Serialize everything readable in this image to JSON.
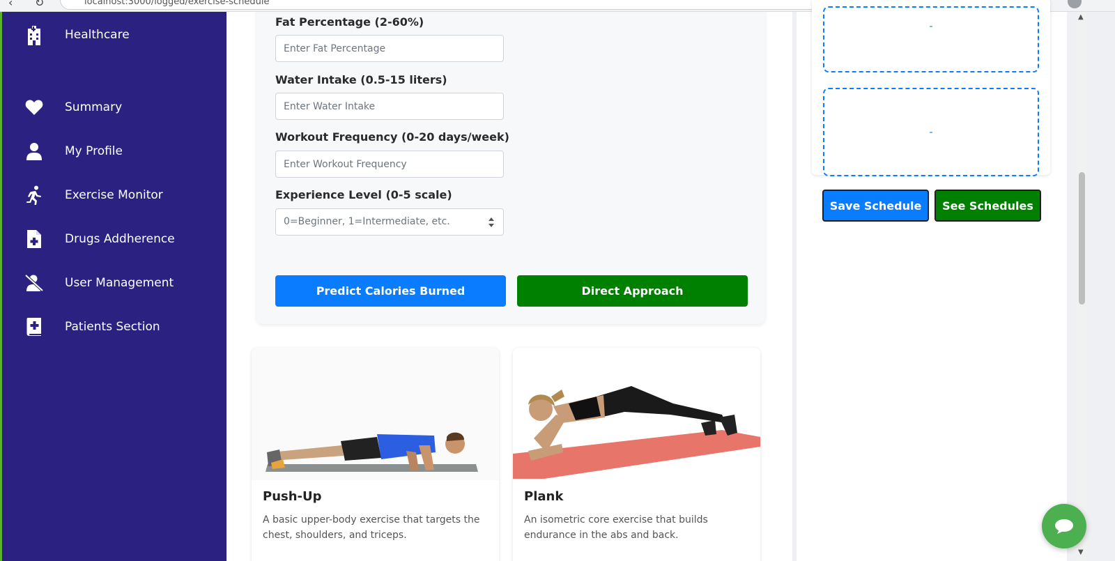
{
  "browser": {
    "url": "localhost:3000/logged/exercise-schedule"
  },
  "sidebar": {
    "brand": {
      "label": "Healthcare",
      "icon": "hospital-icon"
    },
    "items": [
      {
        "label": "Summary",
        "icon": "heart-icon"
      },
      {
        "label": "My Profile",
        "icon": "user-icon"
      },
      {
        "label": "Exercise Monitor",
        "icon": "running-icon"
      },
      {
        "label": "Drugs Addherence",
        "icon": "file-medical-icon"
      },
      {
        "label": "User Management",
        "icon": "user-slash-icon"
      },
      {
        "label": "Patients Section",
        "icon": "medical-book-icon"
      }
    ],
    "background": "#2b2180"
  },
  "form": {
    "fat_label": "Fat Percentage (2-60%)",
    "fat_placeholder": "Enter Fat Percentage",
    "water_label": "Water Intake (0.5-15 liters)",
    "water_placeholder": "Enter Water Intake",
    "workout_label": "Workout Frequency (0-20 days/week)",
    "workout_placeholder": "Enter Workout Frequency",
    "experience_label": "Experience Level (0-5 scale)",
    "experience_selected": "0=Beginner, 1=Intermediate, etc.",
    "predict_button": "Predict Calories Burned",
    "direct_button": "Direct Approach"
  },
  "exercises": [
    {
      "title": "Push-Up",
      "description": "A basic upper-body exercise that targets the chest, shoulders, and triceps."
    },
    {
      "title": "Plank",
      "description": "An isometric core exercise that builds endurance in the abs and back."
    }
  ],
  "schedule": {
    "slots": [
      "-",
      "-"
    ],
    "save_button": "Save Schedule",
    "see_button": "See Schedules"
  },
  "colors": {
    "primary_blue": "#0a7cff",
    "primary_green": "#008000",
    "chat_green": "#4caf50"
  }
}
